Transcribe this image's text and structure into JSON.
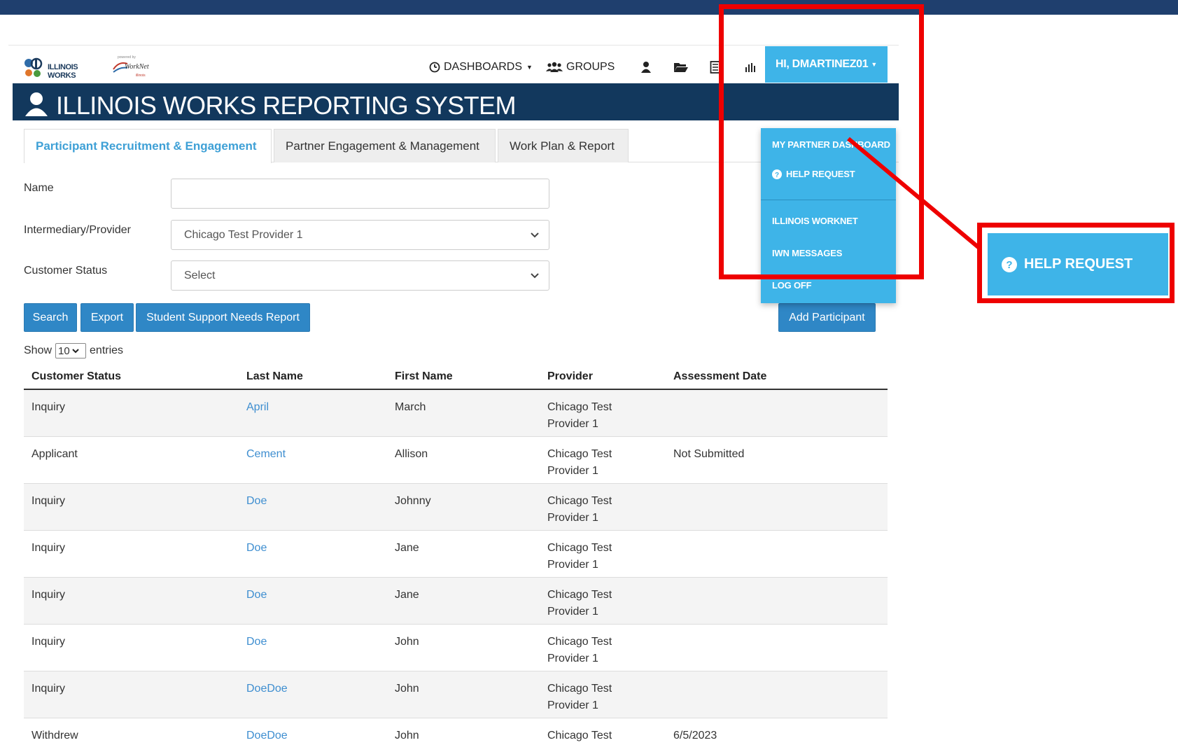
{
  "logos": {
    "illinois_works": "ILLINOIS WORKS",
    "worknet": "WorkNet"
  },
  "nav": {
    "dashboards": "DASHBOARDS",
    "groups": "GROUPS",
    "user": "HI, DMARTINEZ01"
  },
  "banner": {
    "title": "ILLINOIS WORKS REPORTING SYSTEM"
  },
  "tabs": [
    {
      "label": "Participant Recruitment & Engagement",
      "active": true
    },
    {
      "label": "Partner Engagement & Management",
      "active": false
    },
    {
      "label": "Work Plan & Report",
      "active": false
    }
  ],
  "form": {
    "name_label": "Name",
    "name_value": "",
    "provider_label": "Intermediary/Provider",
    "provider_value": "Chicago Test Provider 1",
    "status_label": "Customer Status",
    "status_value": "Select"
  },
  "buttons": {
    "search": "Search",
    "export": "Export",
    "student_report": "Student Support Needs Report",
    "add_participant": "Add Participant"
  },
  "entries": {
    "show": "Show",
    "value": "10",
    "suffix": "entries"
  },
  "table": {
    "headers": [
      "Customer Status",
      "Last Name",
      "First Name",
      "Provider",
      "Assessment Date"
    ],
    "rows": [
      {
        "status": "Inquiry",
        "last": "April",
        "first": "March",
        "provider1": "Chicago Test",
        "provider2": "Provider 1",
        "date": ""
      },
      {
        "status": "Applicant",
        "last": "Cement",
        "first": "Allison",
        "provider1": "Chicago Test",
        "provider2": "Provider 1",
        "date": "Not Submitted"
      },
      {
        "status": "Inquiry",
        "last": "Doe",
        "first": "Johnny",
        "provider1": "Chicago Test",
        "provider2": "Provider 1",
        "date": ""
      },
      {
        "status": "Inquiry",
        "last": "Doe",
        "first": "Jane",
        "provider1": "Chicago Test",
        "provider2": "Provider 1",
        "date": ""
      },
      {
        "status": "Inquiry",
        "last": "Doe",
        "first": "Jane",
        "provider1": "Chicago Test",
        "provider2": "Provider 1",
        "date": ""
      },
      {
        "status": "Inquiry",
        "last": "Doe",
        "first": "John",
        "provider1": "Chicago Test",
        "provider2": "Provider 1",
        "date": ""
      },
      {
        "status": "Inquiry",
        "last": "DoeDoe",
        "first": "John",
        "provider1": "Chicago Test",
        "provider2": "Provider 1",
        "date": ""
      },
      {
        "status": "Withdrew",
        "last": "DoeDoe",
        "first": "John",
        "provider1": "Chicago Test",
        "provider2": "",
        "date": "6/5/2023"
      }
    ]
  },
  "dropdown": {
    "items": [
      "MY PARTNER DASHBOARD",
      "HELP REQUEST",
      "ILLINOIS WORKNET",
      "IWN MESSAGES",
      "LOG OFF"
    ]
  },
  "callout": {
    "label": "HELP REQUEST"
  },
  "colors": {
    "topbar": "#1f3f6e",
    "banner": "#12385d",
    "accent": "#3eb4e8",
    "button": "#2f87c6",
    "highlight": "#ee0000"
  }
}
